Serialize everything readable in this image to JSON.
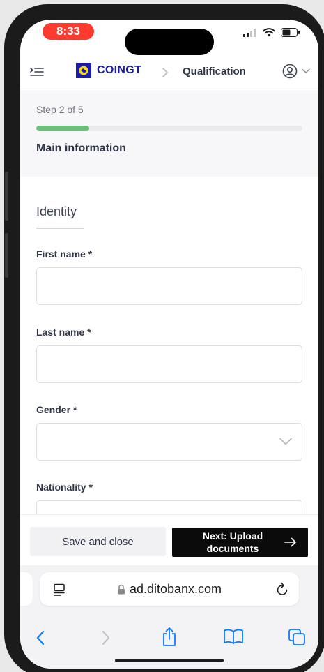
{
  "status_bar": {
    "time": "8:33"
  },
  "header": {
    "brand": "COINGT",
    "breadcrumb_current": "Qualification"
  },
  "progress": {
    "step_label": "Step 2 of 5",
    "fraction": 0.2,
    "section_title": "Main information"
  },
  "form": {
    "group_heading": "Identity",
    "fields": [
      {
        "label": "First name *",
        "value": ""
      },
      {
        "label": "Last name *",
        "value": ""
      },
      {
        "label": "Gender *",
        "value": ""
      },
      {
        "label": "Nationality *",
        "value": ""
      }
    ]
  },
  "actions": {
    "save_label": "Save and close",
    "next_label": "Next: Upload documents"
  },
  "browser": {
    "url": "ad.ditobanx.com"
  },
  "colors": {
    "accent": "#1b1aa8",
    "progress": "#6cbf7a",
    "primary_button": "#0b0b0c",
    "time_pill": "#ff3b30",
    "safari_blue": "#0a7aff"
  }
}
